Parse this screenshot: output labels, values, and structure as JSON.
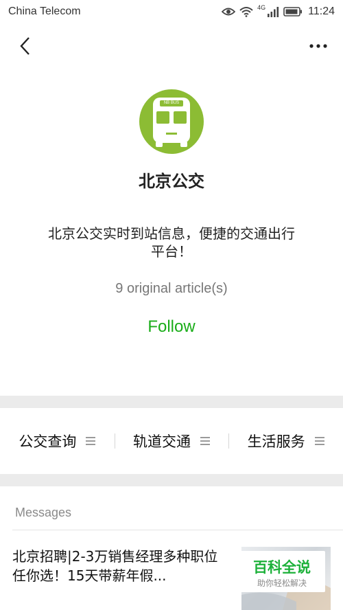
{
  "status_bar": {
    "carrier": "China Telecom",
    "network_label": "4G",
    "time": "11:24"
  },
  "account": {
    "logo_label": "NB BUS",
    "name": "北京公交",
    "description": "北京公交实时到站信息，便捷的交通出行平台！",
    "original_articles": "9 original article(s)",
    "follow_label": "Follow"
  },
  "menu": {
    "items": [
      {
        "label": "公交查询"
      },
      {
        "label": "轨道交通"
      },
      {
        "label": "生活服务"
      }
    ]
  },
  "messages": {
    "section_label": "Messages",
    "articles": [
      {
        "title": "北京招聘|2-3万销售经理多种职位任你选！15天带薪年假..."
      }
    ]
  },
  "watermark": {
    "main": "百科全说",
    "sub": "助你轻松解决"
  },
  "colors": {
    "accent_green": "#1aad19",
    "logo_green": "#8cbc34",
    "separator": "#ebebeb"
  }
}
